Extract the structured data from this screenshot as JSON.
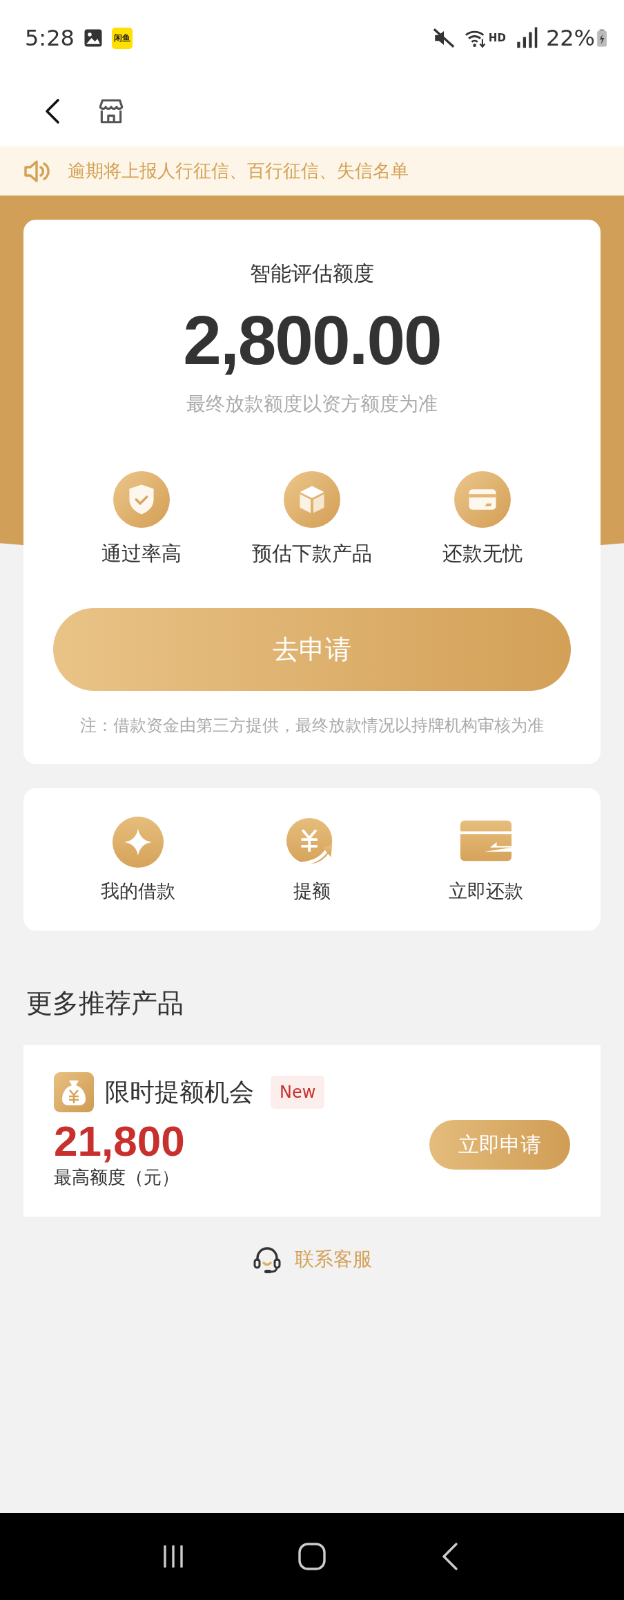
{
  "status_bar": {
    "time": "5:28",
    "app_badge": "闲鱼",
    "network_label": "HD",
    "battery": "22%"
  },
  "notice": "逾期将上报人行征信、百行征信、失信名单",
  "quota": {
    "title": "智能评估额度",
    "amount": "2,800.00",
    "subtitle": "最终放款额度以资方额度为准",
    "features": [
      {
        "label": "通过率高"
      },
      {
        "label": "预估下款产品"
      },
      {
        "label": "还款无忧"
      }
    ],
    "apply_button": "去申请",
    "note": "注：借款资金由第三方提供，最终放款情况以持牌机构审核为准"
  },
  "quick_actions": [
    {
      "label": "我的借款"
    },
    {
      "label": "提额"
    },
    {
      "label": "立即还款"
    }
  ],
  "section_title": "更多推荐产品",
  "product": {
    "name": "限时提额机会",
    "badge": "New",
    "amount": "21,800",
    "amount_label": "最高额度（元）",
    "button": "立即申请"
  },
  "contact": "联系客服"
}
